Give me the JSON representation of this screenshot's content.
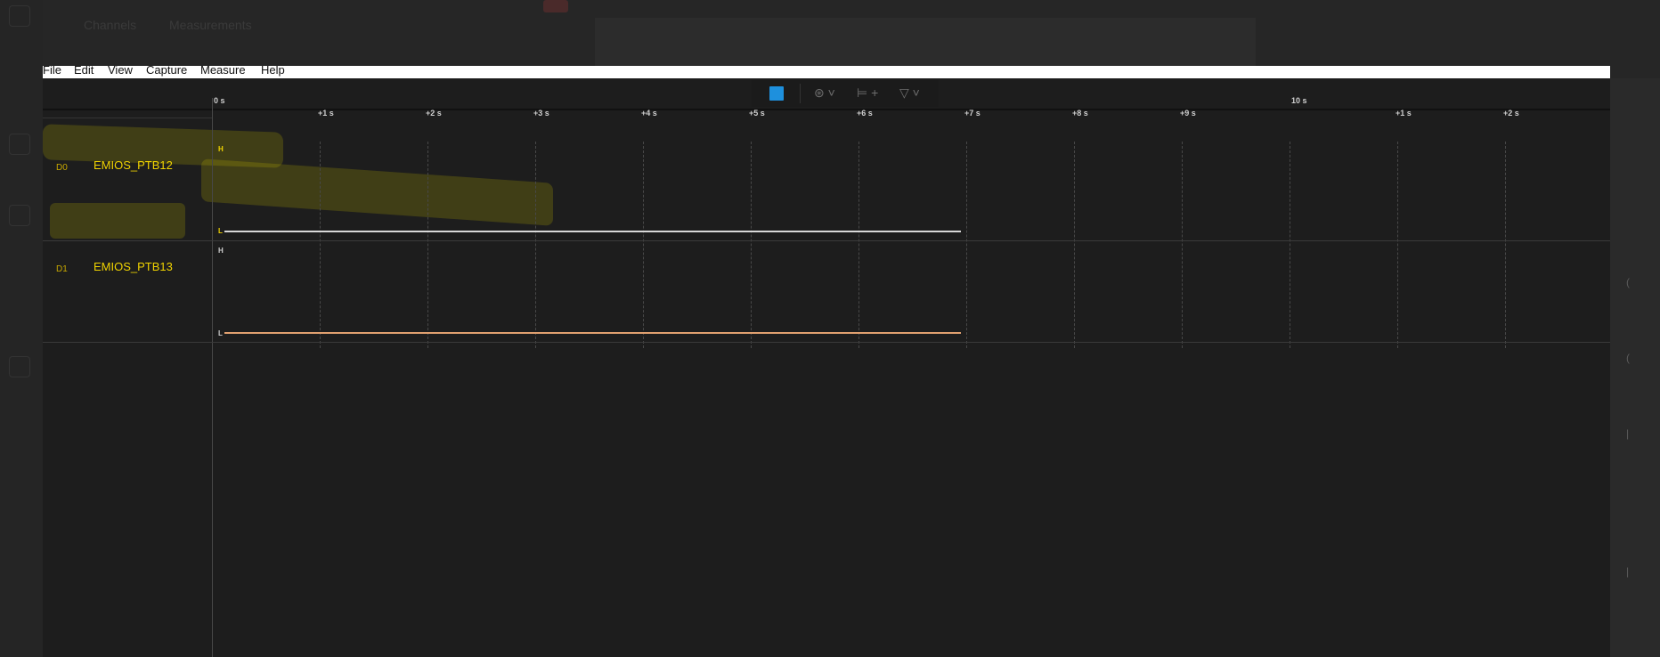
{
  "background": {
    "tabs": [
      "Channels",
      "Measurements"
    ]
  },
  "menu": [
    "File",
    "Edit",
    "View",
    "Capture",
    "Measure",
    "Help"
  ],
  "toolbar": {
    "record_color": "#1e90dd",
    "icons": [
      "trigger-icon",
      "zoom-fit-icon",
      "marker-icon"
    ]
  },
  "ruler": {
    "major_labels": [
      "0 s",
      "10 s"
    ],
    "ticks": [
      "+1 s",
      "+2 s",
      "+3 s",
      "+4 s",
      "+5 s",
      "+6 s",
      "+7 s",
      "+8 s",
      "+9 s",
      "+1 s",
      "+2 s"
    ]
  },
  "channels": [
    {
      "label": "D0",
      "name": "EMIOS_PTB12",
      "high": "H",
      "low": "L",
      "color": "#f0d300",
      "trace_color": "#d8d8d8"
    },
    {
      "label": "D1",
      "name": "EMIOS_PTB13",
      "high": "H",
      "low": "L",
      "color": "#f0d300",
      "trace_color": "#e0a070"
    }
  ]
}
